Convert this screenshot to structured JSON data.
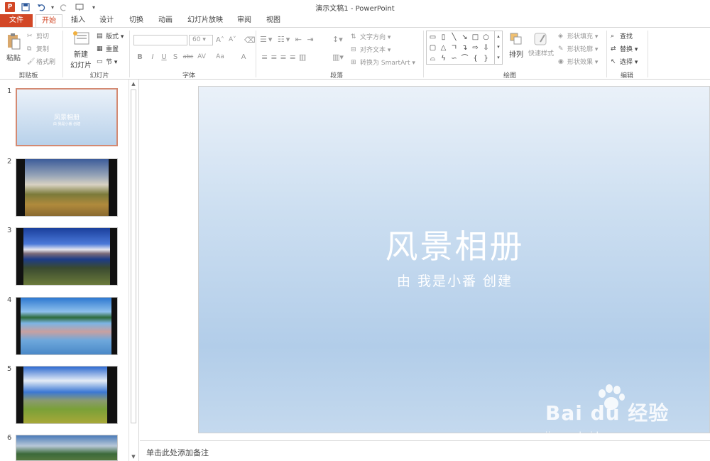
{
  "window": {
    "title": "演示文稿1 - PowerPoint",
    "app_icon": "powerpoint-icon",
    "quick_access": [
      "save-icon",
      "undo-icon",
      "redo-icon",
      "slideshow-from-start-icon",
      "customize-dropdown-icon"
    ]
  },
  "tabs": [
    {
      "label": "文件",
      "name": "tab-file"
    },
    {
      "label": "开始",
      "name": "tab-home",
      "active": true
    },
    {
      "label": "插入",
      "name": "tab-insert"
    },
    {
      "label": "设计",
      "name": "tab-design"
    },
    {
      "label": "切换",
      "name": "tab-transitions"
    },
    {
      "label": "动画",
      "name": "tab-animations"
    },
    {
      "label": "幻灯片放映",
      "name": "tab-slideshow"
    },
    {
      "label": "审阅",
      "name": "tab-review"
    },
    {
      "label": "视图",
      "name": "tab-view"
    }
  ],
  "ribbon": {
    "clipboard": {
      "label": "剪贴板",
      "paste": "粘贴",
      "cut": "剪切",
      "copy": "复制",
      "format_painter": "格式刷"
    },
    "slides": {
      "label": "幻灯片",
      "new_slide_line1": "新建",
      "new_slide_line2": "幻灯片",
      "layout": "版式",
      "reset": "重置",
      "section": "节"
    },
    "font": {
      "label": "字体",
      "font_name": "",
      "font_size": "60",
      "bold": "B",
      "italic": "I",
      "underline": "U",
      "shadow": "S",
      "strikethrough": "abc",
      "spacing": "AV",
      "case": "Aa",
      "color": "A"
    },
    "paragraph": {
      "label": "段落",
      "text_direction": "文字方向",
      "align_text": "对齐文本",
      "convert_smartart": "转换为 SmartArt"
    },
    "drawing": {
      "label": "绘图",
      "arrange": "排列",
      "quick_styles": "快速样式",
      "shape_fill": "形状填充",
      "shape_outline": "形状轮廓",
      "shape_effects": "形状效果"
    },
    "editing": {
      "label": "编辑",
      "find": "查找",
      "replace": "替换",
      "select": "选择"
    }
  },
  "thumbnails": [
    {
      "num": "1",
      "title": "风景相册",
      "subtitle": "由 我是小番 创建",
      "selected": true
    },
    {
      "num": "2",
      "image": "landscape-road-clouds"
    },
    {
      "num": "3",
      "image": "lake-mountains-blue-sky"
    },
    {
      "num": "4",
      "image": "lake-reflection-clouds"
    },
    {
      "num": "5",
      "image": "grassland-blue-sky"
    },
    {
      "num": "6",
      "image": "mountain-valley"
    }
  ],
  "slide": {
    "title": "风景相册",
    "subtitle": "由 我是小番 创建"
  },
  "notes": {
    "placeholder": "单击此处添加备注"
  },
  "watermark": {
    "logo": "Bai du 经验",
    "url": "jingyanbaidu.com"
  },
  "colors": {
    "accent": "#d24726",
    "slide_top": "#eaf1f9",
    "slide_bottom": "#b2cde9"
  }
}
